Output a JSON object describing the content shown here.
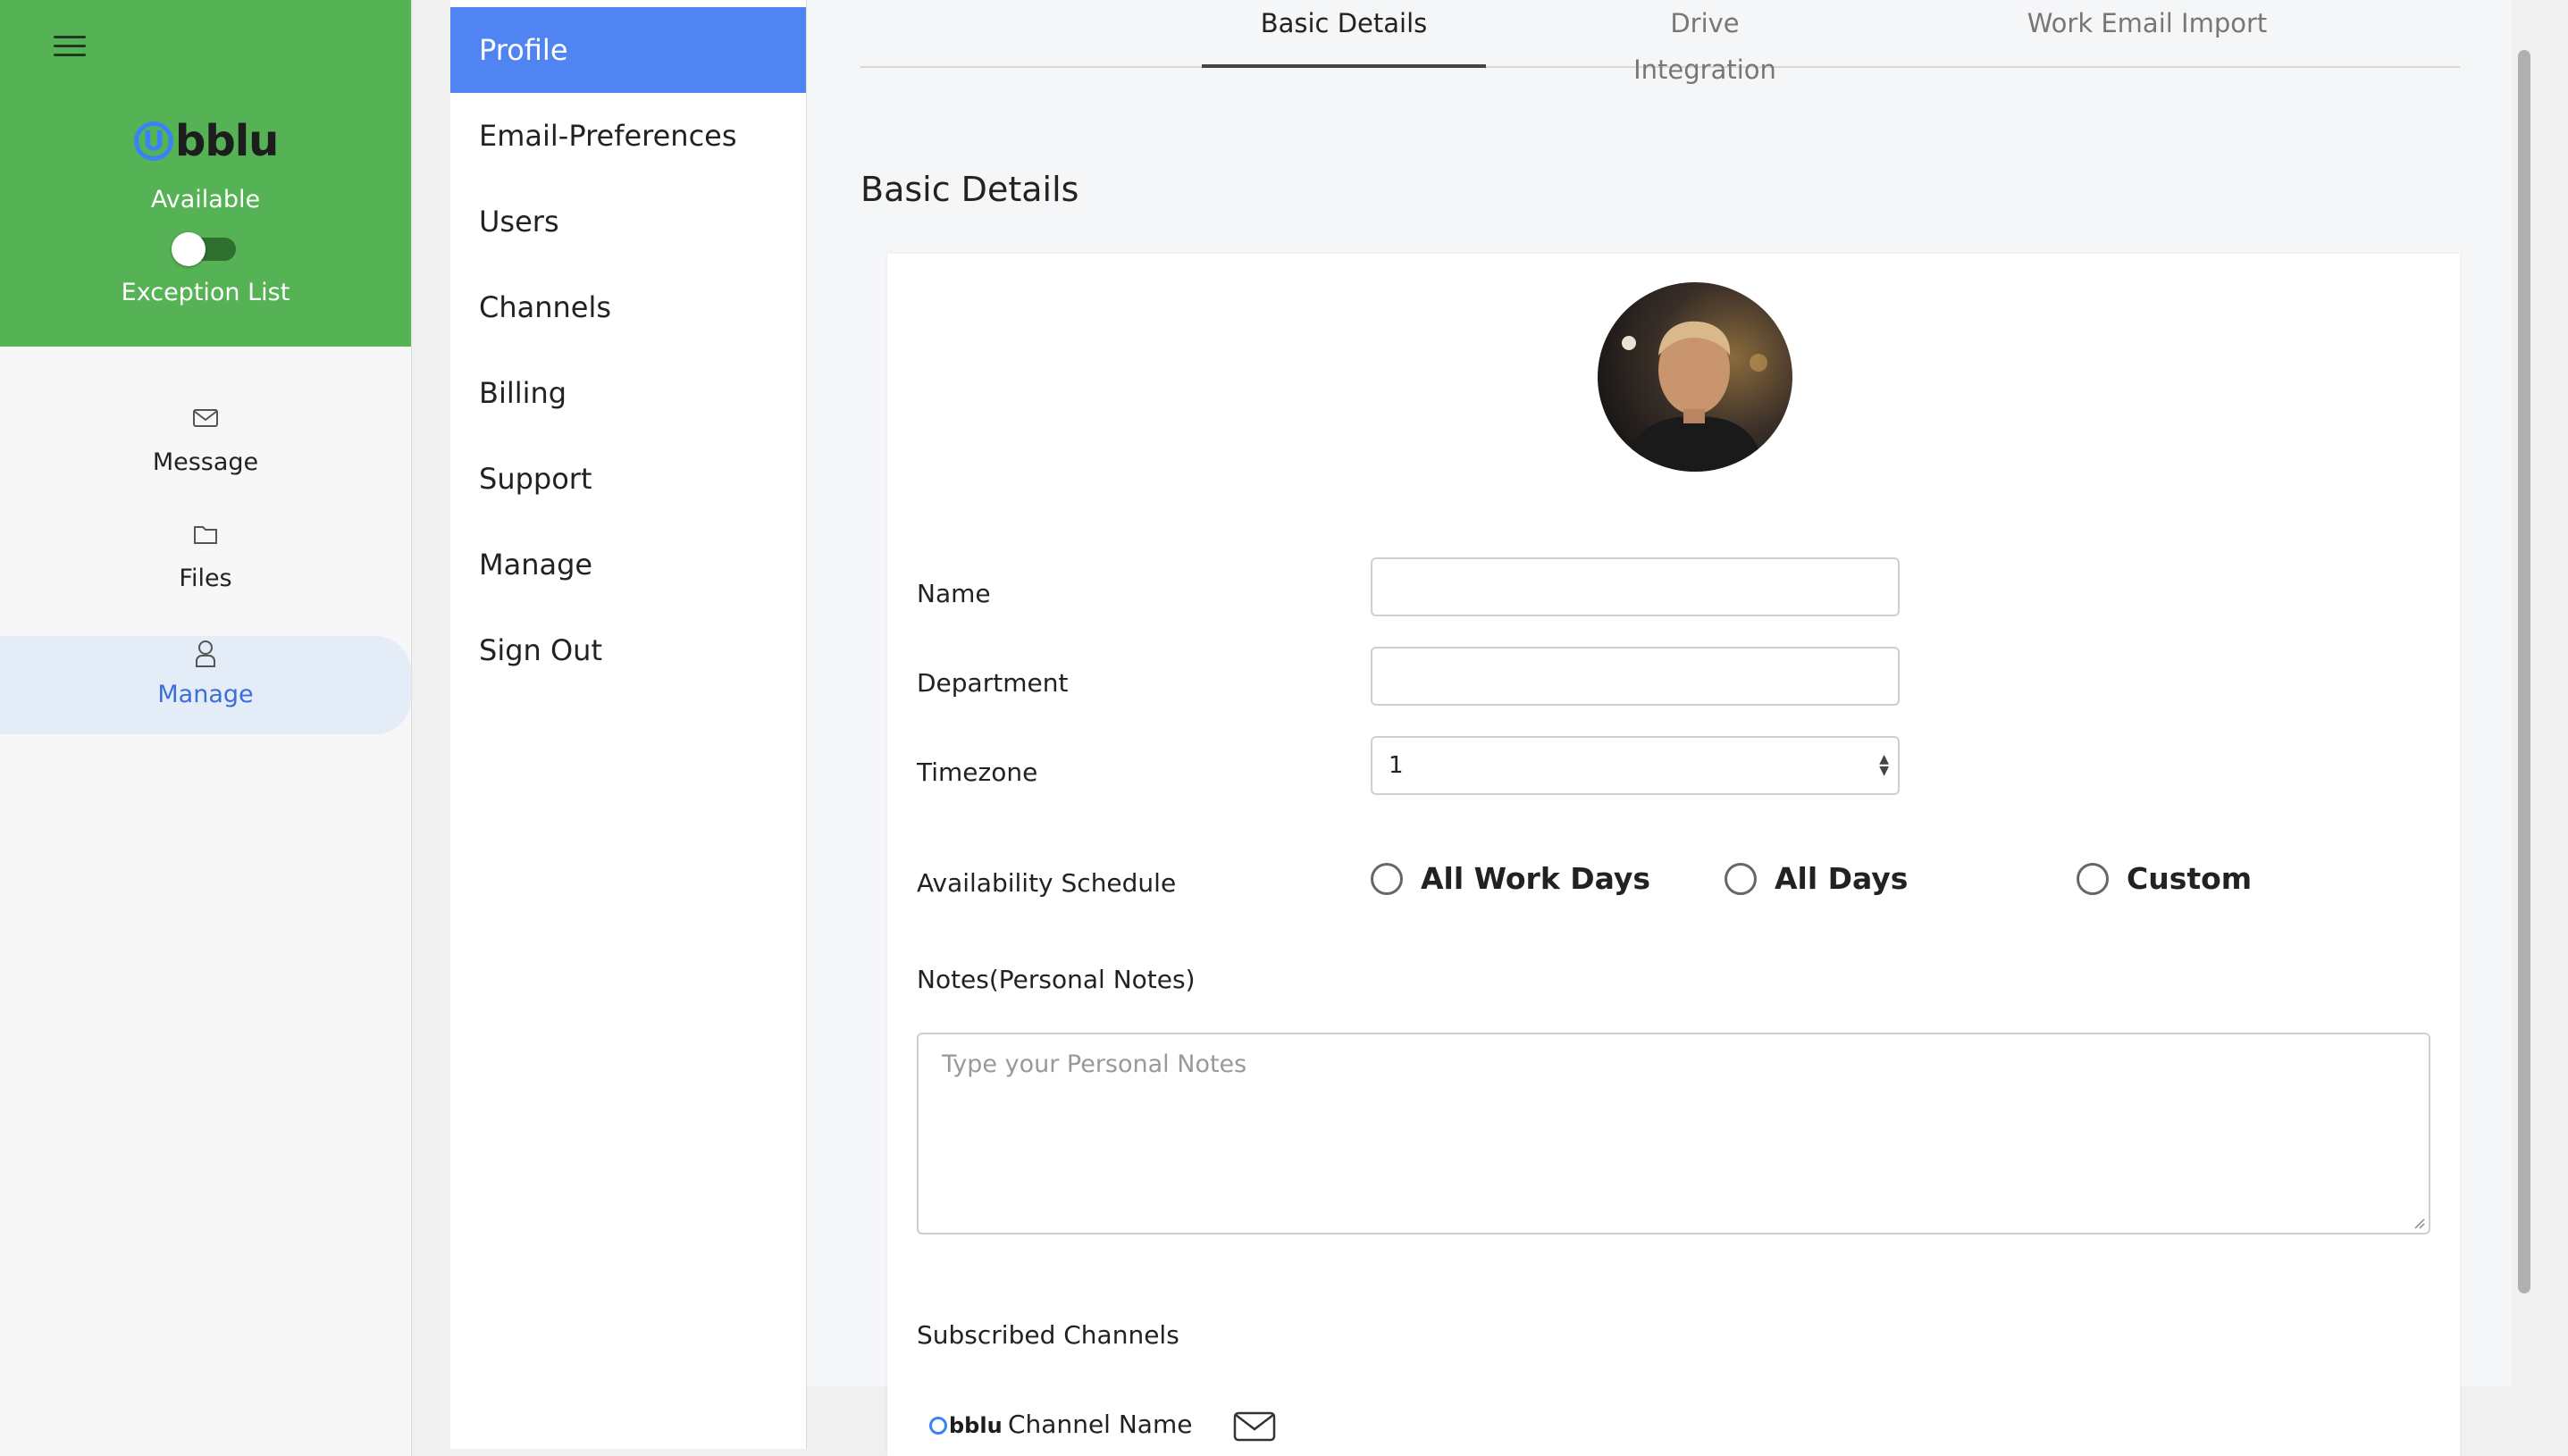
{
  "app": {
    "logo_text": "bblu",
    "logo_letter": "U"
  },
  "rail": {
    "status_label": "Available",
    "exception_label": "Exception List",
    "items": [
      {
        "label": "Message",
        "icon": "envelope-icon"
      },
      {
        "label": "Files",
        "icon": "folder-icon"
      },
      {
        "label": "Manage",
        "icon": "user-icon",
        "active": true
      }
    ]
  },
  "menu": {
    "items": [
      "Profile",
      "Email-Preferences",
      "Users",
      "Channels",
      "Billing",
      "Support",
      "Manage",
      "Sign Out"
    ],
    "active": "Profile"
  },
  "tabs": [
    "Basic Details",
    "Drive Integration",
    "Work Email Import"
  ],
  "main": {
    "section_title": "Basic Details",
    "form": {
      "name_label": "Name",
      "name_value": "",
      "department_label": "Department",
      "department_value": "",
      "timezone_label": "Timezone",
      "timezone_value": "1",
      "availability_label": "Availability Schedule",
      "availability_options": [
        "All Work Days",
        "All Days",
        "Custom"
      ],
      "notes_label": "Notes(Personal Notes)",
      "notes_placeholder": "Type your Personal Notes",
      "subscribed_label": "Subscribed Channels",
      "channel_name": "Channel Name"
    }
  },
  "colors": {
    "rail_green": "#55b255",
    "accent_blue": "#4f84f2",
    "active_text_blue": "#3a6fd8"
  }
}
